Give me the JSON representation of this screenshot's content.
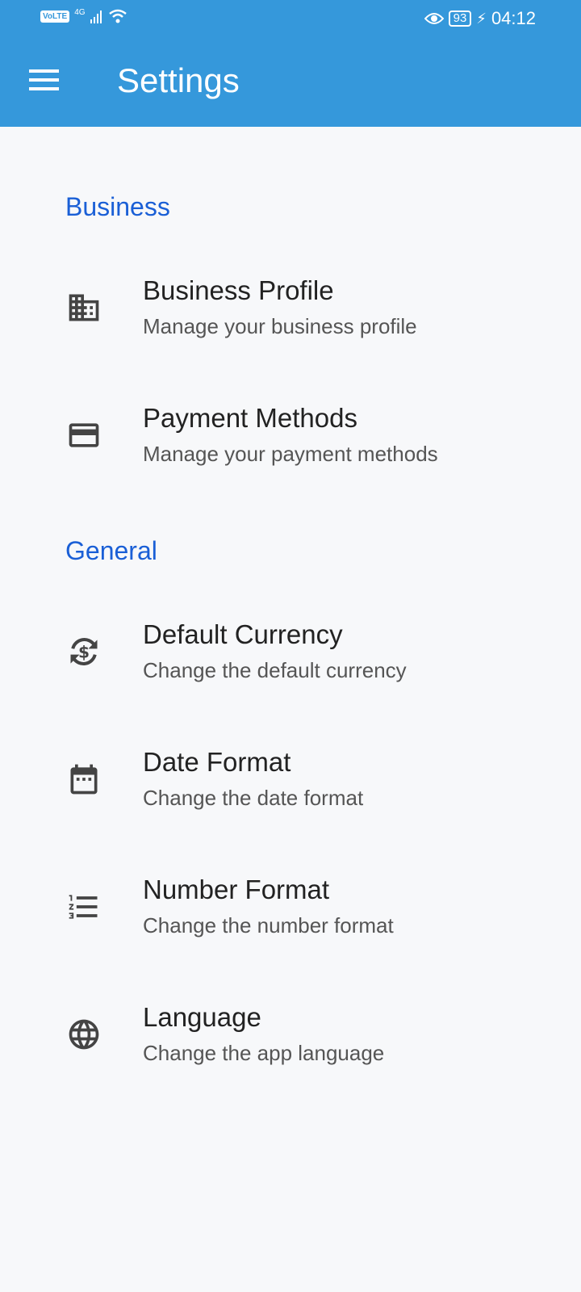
{
  "status_bar": {
    "network": "VoLTE",
    "signal": "4G",
    "battery": "93",
    "time": "04:12"
  },
  "header": {
    "title": "Settings"
  },
  "sections": [
    {
      "label": "Business",
      "items": [
        {
          "title": "Business Profile",
          "subtitle": "Manage your business profile",
          "icon": "business-icon"
        },
        {
          "title": "Payment Methods",
          "subtitle": "Manage your payment methods",
          "icon": "credit-card-icon"
        }
      ]
    },
    {
      "label": "General",
      "items": [
        {
          "title": "Default Currency",
          "subtitle": "Change the default currency",
          "icon": "currency-exchange-icon"
        },
        {
          "title": "Date Format",
          "subtitle": "Change the date format",
          "icon": "calendar-icon"
        },
        {
          "title": "Number Format",
          "subtitle": "Change the number format",
          "icon": "numbered-list-icon"
        },
        {
          "title": "Language",
          "subtitle": "Change the app language",
          "icon": "globe-icon"
        }
      ]
    }
  ],
  "colors": {
    "appbar": "#3598db",
    "section": "#1a5fd6",
    "background": "#f7f8fa"
  }
}
